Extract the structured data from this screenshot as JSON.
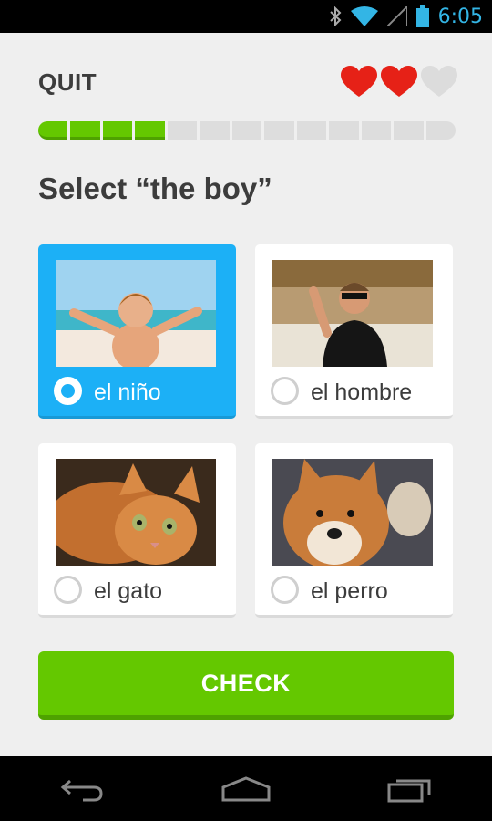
{
  "status_bar": {
    "time": "6:05"
  },
  "header": {
    "quit_label": "QUIT",
    "hearts": {
      "full": 2,
      "total": 3
    }
  },
  "progress": {
    "completed": 4,
    "total": 13
  },
  "prompt": {
    "text": "Select “the boy”"
  },
  "options": [
    {
      "label": "el niño",
      "image": "boy-on-beach",
      "selected": true
    },
    {
      "label": "el hombre",
      "image": "man-waving",
      "selected": false
    },
    {
      "label": "el gato",
      "image": "orange-cat",
      "selected": false
    },
    {
      "label": "el perro",
      "image": "shiba-dog",
      "selected": false
    }
  ],
  "check_button": {
    "label": "CHECK"
  },
  "colors": {
    "green": "#64c800",
    "blue": "#1cb0f6",
    "heart": "#e62117",
    "status_blue": "#33b5e5"
  }
}
